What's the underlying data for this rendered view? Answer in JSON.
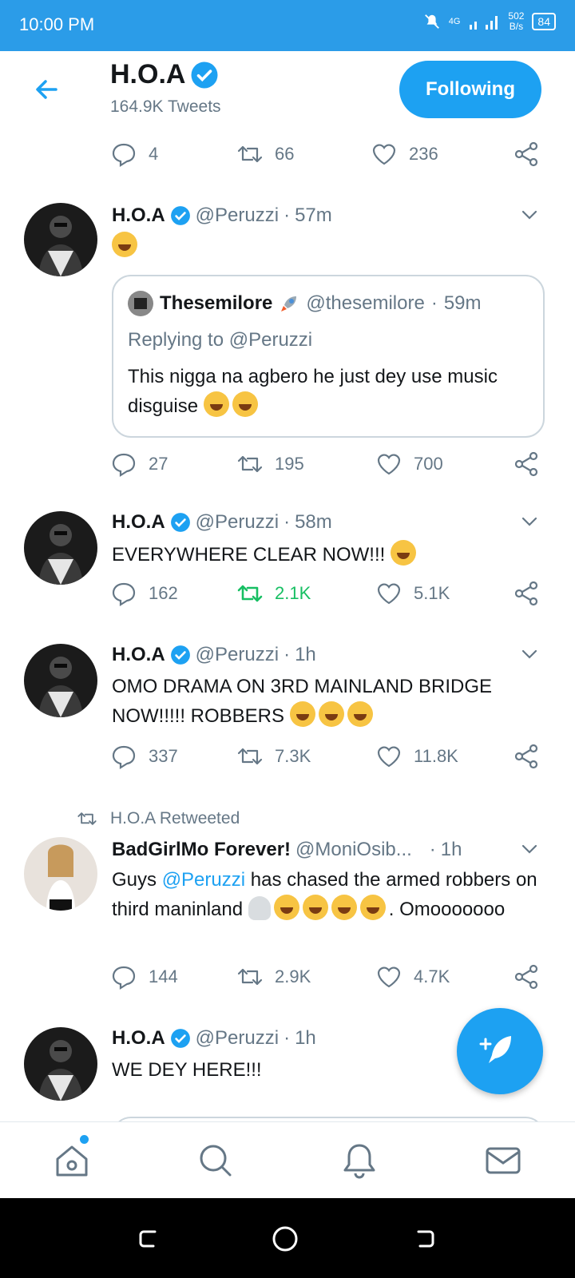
{
  "status": {
    "time": "10:00 PM",
    "network": "4G",
    "speed_value": "502",
    "speed_unit": "B/s",
    "battery": "84"
  },
  "header": {
    "name": "H.O.A",
    "tweet_count": "164.9K Tweets",
    "follow_label": "Following"
  },
  "colors": {
    "accent": "#1da1f2",
    "status_bar": "#2b9ce8",
    "retweet_green": "#17bf63",
    "muted": "#657786"
  },
  "top_actions": {
    "replies": "4",
    "retweets": "66",
    "likes": "236"
  },
  "tweets": [
    {
      "name": "H.O.A",
      "handle": "@Peruzzi",
      "sep": "·",
      "time": "57m",
      "quote": {
        "name": "Thesemilore",
        "handle": "@thesemilore",
        "time": "59m",
        "replying": "Replying to @Peruzzi",
        "text": "This nigga na agbero he just dey use music disguise"
      },
      "replies": "27",
      "retweets": "195",
      "likes": "700"
    },
    {
      "name": "H.O.A",
      "handle": "@Peruzzi",
      "time": "58m",
      "text": "EVERYWHERE CLEAR NOW!!!",
      "replies": "162",
      "retweets": "2.1K",
      "likes": "5.1K"
    },
    {
      "name": "H.O.A",
      "handle": "@Peruzzi",
      "time": "1h",
      "text": "OMO DRAMA ON 3RD MAINLAND BRIDGE NOW!!!!! ROBBERS",
      "replies": "337",
      "retweets": "7.3K",
      "likes": "11.8K"
    },
    {
      "retweeted_by": "H.O.A Retweeted",
      "name": "BadGirlMo Forever!",
      "handle": "@MoniOsib...",
      "time": "1h",
      "text_pre": "Guys ",
      "mention": "@Peruzzi",
      "text_post": " has chased the armed robbers on third maninland",
      "text_end": ". Omooooooo",
      "replies": "144",
      "retweets": "2.9K",
      "likes": "4.7K"
    },
    {
      "name": "H.O.A",
      "handle": "@Peruzzi",
      "time": "1h",
      "text": "WE DEY HERE!!!"
    }
  ],
  "nav": {
    "icons": [
      "home-icon",
      "search-icon",
      "notifications-icon",
      "messages-icon"
    ]
  }
}
